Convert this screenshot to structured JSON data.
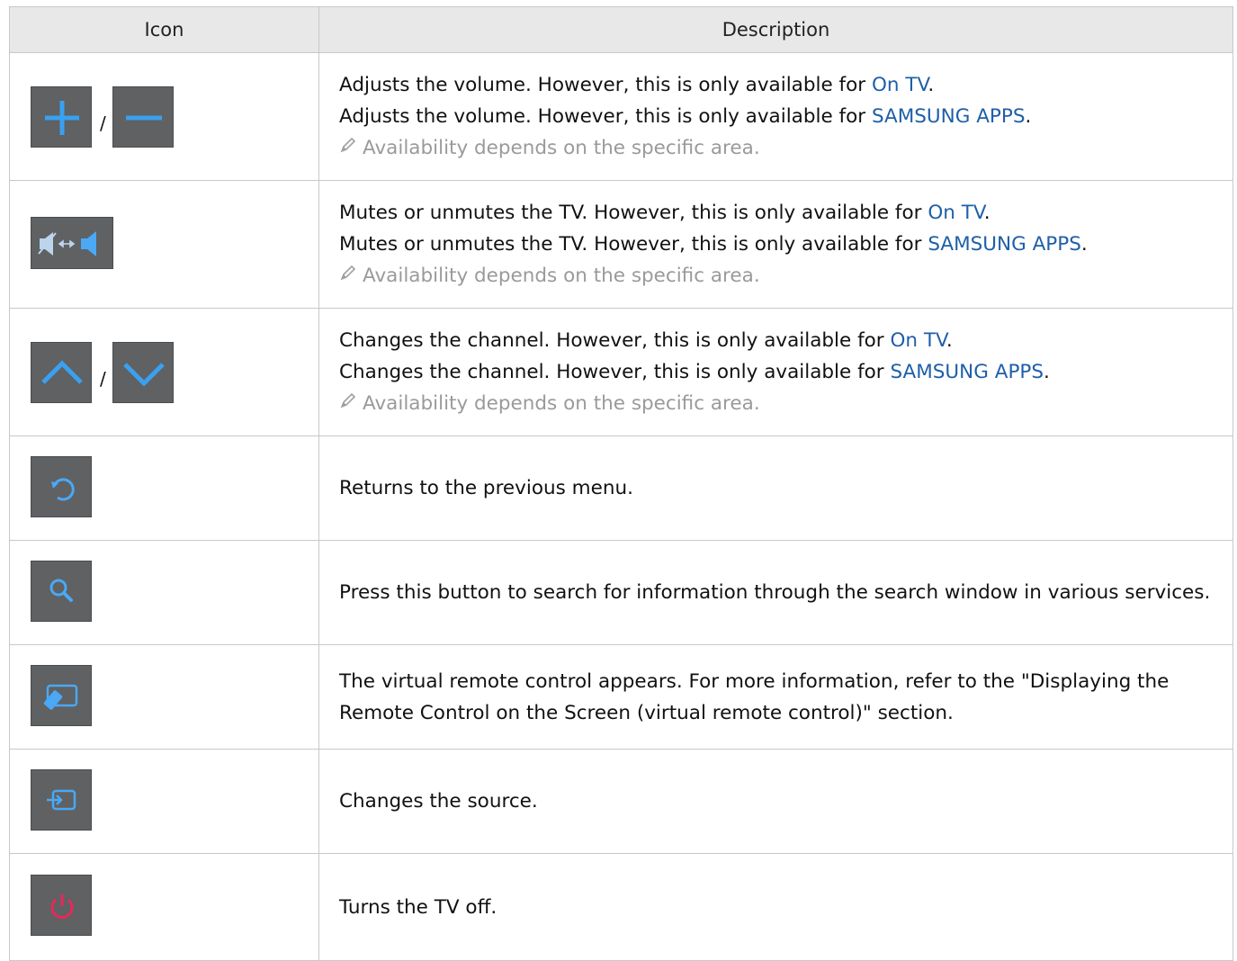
{
  "header": {
    "icon": "Icon",
    "description": "Description"
  },
  "colors": {
    "link": "#1f5fa8",
    "note": "#9a9a9a",
    "button_bg": "#5f6163",
    "icon_blue": "#3aa0f0",
    "power_red": "#e8285a"
  },
  "rows": [
    {
      "icons": [
        "plus-icon",
        "minus-icon"
      ],
      "separator": "/",
      "lines": [
        {
          "pre": "Adjusts the volume. However, this is only available for ",
          "link": "On TV",
          "post": "."
        },
        {
          "pre": "Adjusts the volume. However, this is only available for ",
          "link": "SAMSUNG APPS",
          "post": "."
        }
      ],
      "note": "Availability depends on the specific area."
    },
    {
      "icons": [
        "mute-toggle-icon"
      ],
      "lines": [
        {
          "pre": "Mutes or unmutes the TV. However, this is only available for ",
          "link": "On TV",
          "post": "."
        },
        {
          "pre": "Mutes or unmutes the TV. However, this is only available for ",
          "link": "SAMSUNG APPS",
          "post": "."
        }
      ],
      "note": "Availability depends on the specific area."
    },
    {
      "icons": [
        "chevron-up-icon",
        "chevron-down-icon"
      ],
      "separator": "/",
      "lines": [
        {
          "pre": "Changes the channel. However, this is only available for ",
          "link": "On TV",
          "post": "."
        },
        {
          "pre": "Changes the channel. However, this is only available for ",
          "link": "SAMSUNG APPS",
          "post": "."
        }
      ],
      "note": "Availability depends on the specific area."
    },
    {
      "icons": [
        "return-icon"
      ],
      "text": "Returns to the previous menu."
    },
    {
      "icons": [
        "search-icon"
      ],
      "text": "Press this button to search for information through the search window in various services."
    },
    {
      "icons": [
        "virtual-remote-icon"
      ],
      "text": "The virtual remote control appears. For more information, refer to the \"Displaying the Remote Control on the Screen (virtual remote control)\" section."
    },
    {
      "icons": [
        "source-icon"
      ],
      "text": "Changes the source."
    },
    {
      "icons": [
        "power-icon"
      ],
      "text": "Turns the TV off."
    }
  ]
}
